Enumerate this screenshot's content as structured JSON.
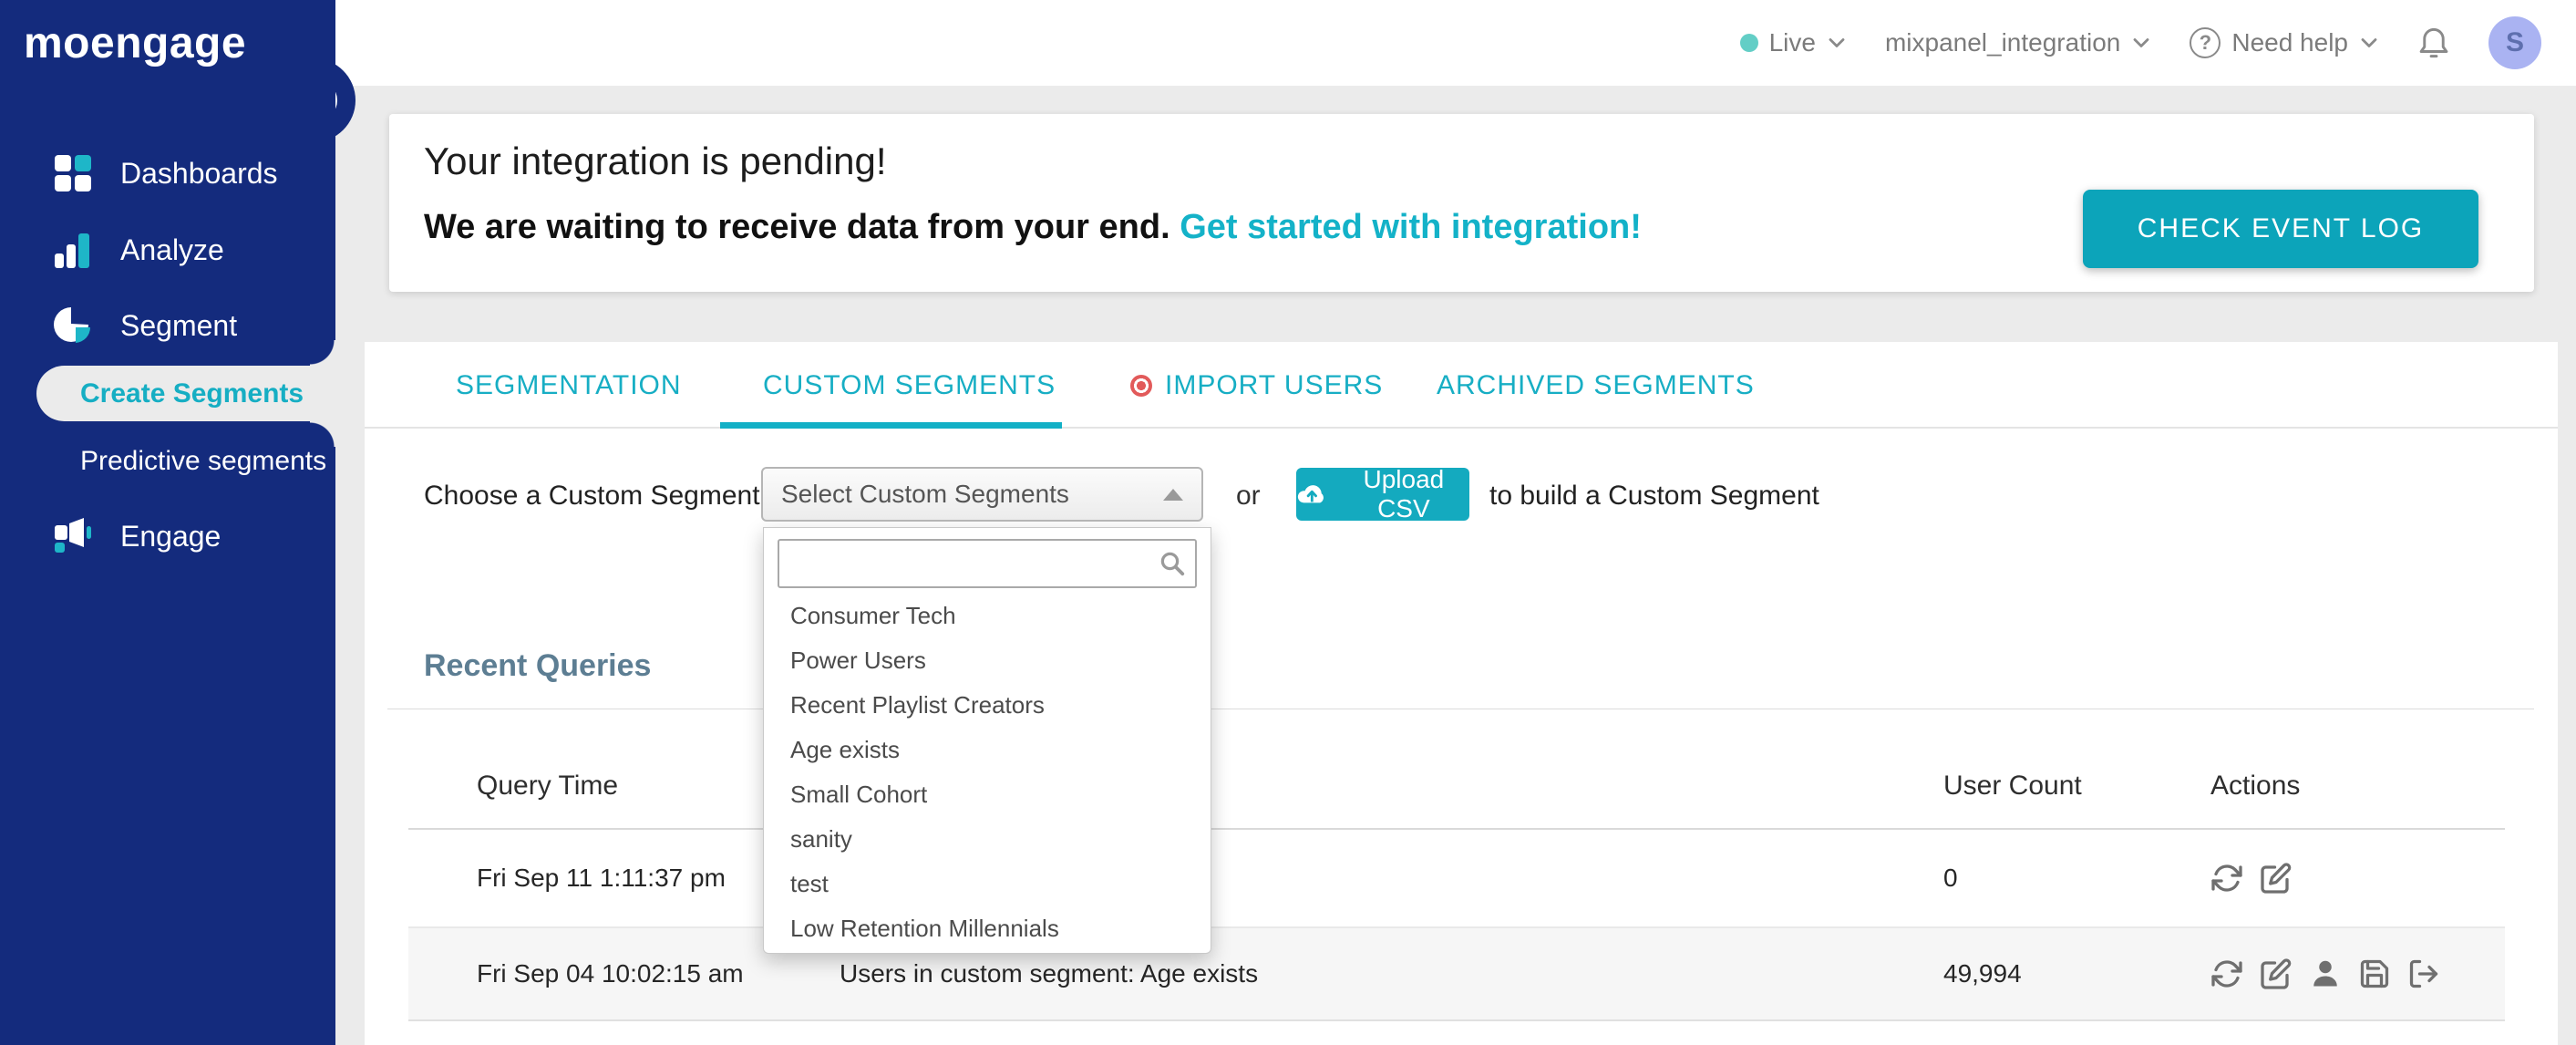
{
  "colors": {
    "navy": "#142B7D",
    "teal_button": "#0CA4BA",
    "teal_link": "#14B2C8",
    "tab_teal": "#17AEC4",
    "heading_slate": "#5D7E93",
    "import_dot_red": "#E25A5A",
    "avatar_bg": "#AAB3F2",
    "live_dot": "#63CEC6",
    "content_bg": "#EBEBEB"
  },
  "topbar": {
    "live_label": "Live",
    "workspace": "mixpanel_integration",
    "help_mark": "?",
    "need_help": "Need help",
    "avatar_initial": "S"
  },
  "sidebar": {
    "logo": "moengage",
    "items": [
      {
        "label": "Dashboards"
      },
      {
        "label": "Analyze"
      },
      {
        "label": "Segment"
      },
      {
        "label": "Engage"
      }
    ],
    "submenu": {
      "active": "Create Segments",
      "second": "Predictive segments"
    }
  },
  "banner": {
    "title": "Your integration is pending!",
    "message": "We are waiting to receive data from your end. ",
    "link": "Get started with integration!",
    "button": "CHECK EVENT LOG"
  },
  "tabs": [
    {
      "label": "SEGMENTATION"
    },
    {
      "label": "CUSTOM SEGMENTS"
    },
    {
      "label": "IMPORT USERS"
    },
    {
      "label": "ARCHIVED SEGMENTS"
    }
  ],
  "chooser": {
    "label": "Choose a Custom Segment:",
    "select_value": "Select Custom Segments",
    "or": "or",
    "upload_button": "Upload CSV",
    "suffix": "to build a Custom Segment",
    "search_placeholder": ""
  },
  "dropdown": {
    "options": [
      "Consumer Tech",
      "Power Users",
      "Recent Playlist Creators",
      "Age exists",
      "Small Cohort",
      "sanity",
      "test",
      "Low Retention Millennials"
    ]
  },
  "recent_queries": {
    "heading": "Recent Queries",
    "columns": {
      "time": "Query Time",
      "count": "User Count",
      "actions": "Actions"
    },
    "rows": [
      {
        "time": "Fri Sep 11 1:11:37 pm",
        "query": "",
        "count": "0"
      },
      {
        "time": "Fri Sep 04 10:02:15 am",
        "query": "Users in custom segment: Age exists",
        "count": "49,994"
      }
    ]
  }
}
